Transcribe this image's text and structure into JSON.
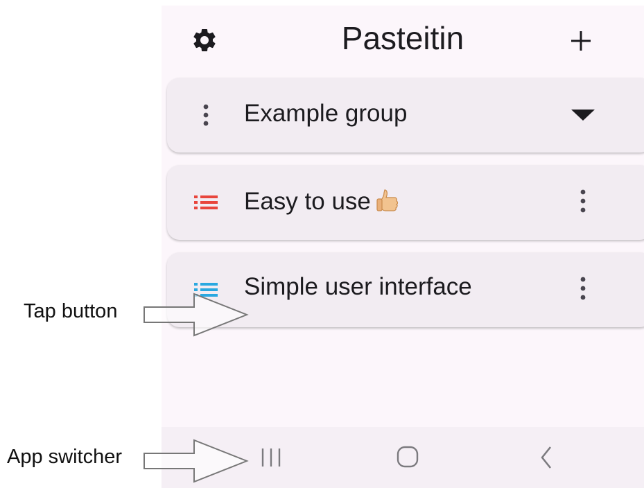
{
  "app": {
    "title": "Pasteitin",
    "settings_icon": "gear-icon",
    "add_icon": "plus-icon"
  },
  "cards": [
    {
      "label": "Example group",
      "leading_icon": "more-vert-icon",
      "trailing_icon": "dropdown-arrow-icon"
    },
    {
      "label": "Easy to use",
      "emoji": "thumbs-up",
      "leading_icon": "list-icon",
      "leading_color": "#e8453c",
      "trailing_icon": "more-vert-icon"
    },
    {
      "label": "Simple user interface",
      "leading_icon": "list-icon",
      "leading_color": "#2aa8e0",
      "trailing_icon": "more-vert-icon"
    }
  ],
  "navbar": {
    "recents_icon": "recents-icon",
    "home_icon": "home-icon",
    "back_icon": "back-icon"
  },
  "annotations": {
    "tap_button": "Tap button",
    "app_switcher": "App switcher"
  },
  "colors": {
    "background": "#fcf6fb",
    "card": "#f2ecf2",
    "text": "#1c1b1f"
  }
}
